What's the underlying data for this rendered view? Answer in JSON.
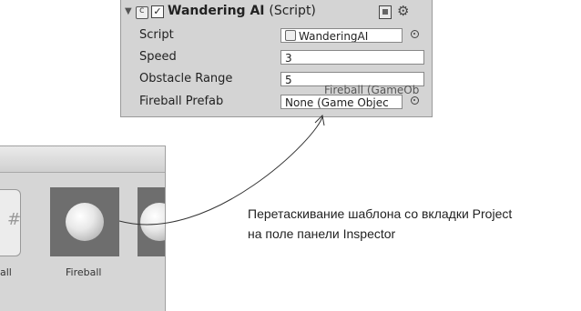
{
  "inspector": {
    "component": {
      "title": "Wandering AI",
      "suffix": "(Script)",
      "enabled_mark": "✓"
    },
    "fields": [
      {
        "label": "Script",
        "value": "WanderingAI",
        "kind": "object"
      },
      {
        "label": "Speed",
        "value": "3",
        "kind": "number"
      },
      {
        "label": "Obstacle Range",
        "value": "5",
        "kind": "number"
      },
      {
        "label": "Fireball Prefab",
        "value": "None (Game Objec",
        "kind": "object"
      }
    ],
    "drag_ghost": "Fireball (GameOb",
    "icons": [
      "foldout-arrow-icon",
      "script-icon",
      "book-icon",
      "gear-icon",
      "object-picker-icon"
    ]
  },
  "project": {
    "assets": [
      {
        "label": "all",
        "partial": true
      },
      {
        "label": "Fireball",
        "partial": false
      }
    ]
  },
  "caption": {
    "line1": "Перетаскивание шаблона со вкладки Project",
    "line2": "на поле панели Inspector"
  },
  "colors": {
    "panel_bg": "#d4d4d4",
    "thumb_bg": "#6e6e6e",
    "field_bg": "#ffffff"
  }
}
